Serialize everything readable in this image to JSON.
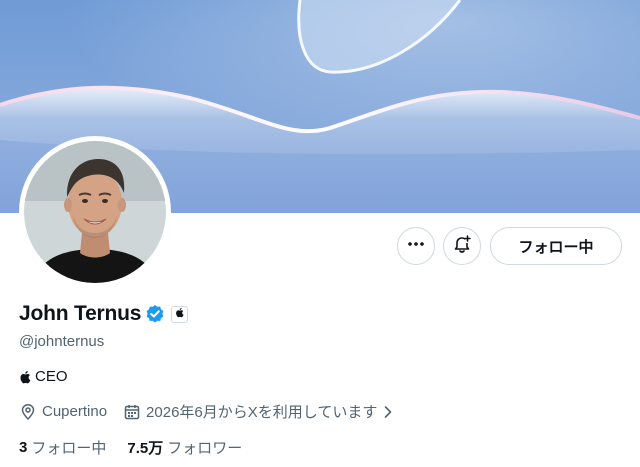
{
  "profile": {
    "name": "John Ternus",
    "handle": "@johnternus",
    "bio": "CEO",
    "location": "Cupertino",
    "joined": "2026年6月からXを利用しています",
    "following_count": "3",
    "following_label": "フォロー中",
    "followers_count": "7.5万",
    "followers_label": "フォロワー"
  },
  "actions": {
    "more_label": "…",
    "follow_label": "フォロー中"
  },
  "colors": {
    "verified_blue": "#1d9bf0",
    "banner_sky": "#7ea2d8",
    "text_secondary": "#536471"
  },
  "icons": [
    "more-icon",
    "bell-plus-icon",
    "verified-badge-icon",
    "apple-logo-icon",
    "location-pin-icon",
    "calendar-icon",
    "chevron-right-icon"
  ]
}
